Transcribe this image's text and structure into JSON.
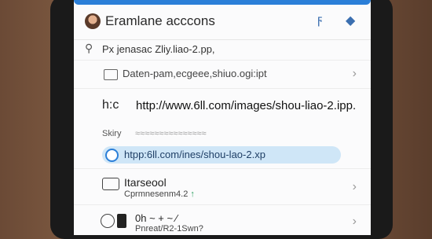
{
  "app": {
    "title": "Eramlane acccons"
  },
  "search": {
    "text": "Px jenasac Zliy.liao-2.pp,"
  },
  "rows": [
    {
      "text": "Daten-pam,ecgeee,shiuo.ogi:ipt"
    },
    {
      "prefix": "h:c",
      "url": "http://www.6ll.com/images/shou-liao-2.ipp."
    }
  ],
  "section": {
    "label": "Skiry",
    "rest": "≈≈≈≈≈≈≈≈≈≈≈≈≈≈≈"
  },
  "suggestion": {
    "text": "htpp:6ll.com/ines/shou-lao-2.xp"
  },
  "row3": {
    "title": "Itarseool",
    "sub": "Cprmnesenm4.2",
    "arrow": "↑"
  },
  "row4": {
    "title": "0h  ~  +  ~  ⁄",
    "sub": "Pnreat/R2-1Swn?"
  },
  "icons": {
    "chevron": "›",
    "tb1": "ϝ",
    "tb2": "◆",
    "search": "ℚ"
  },
  "colors": {
    "accent": "#2b7fd8",
    "pill": "#cfe6f7"
  }
}
